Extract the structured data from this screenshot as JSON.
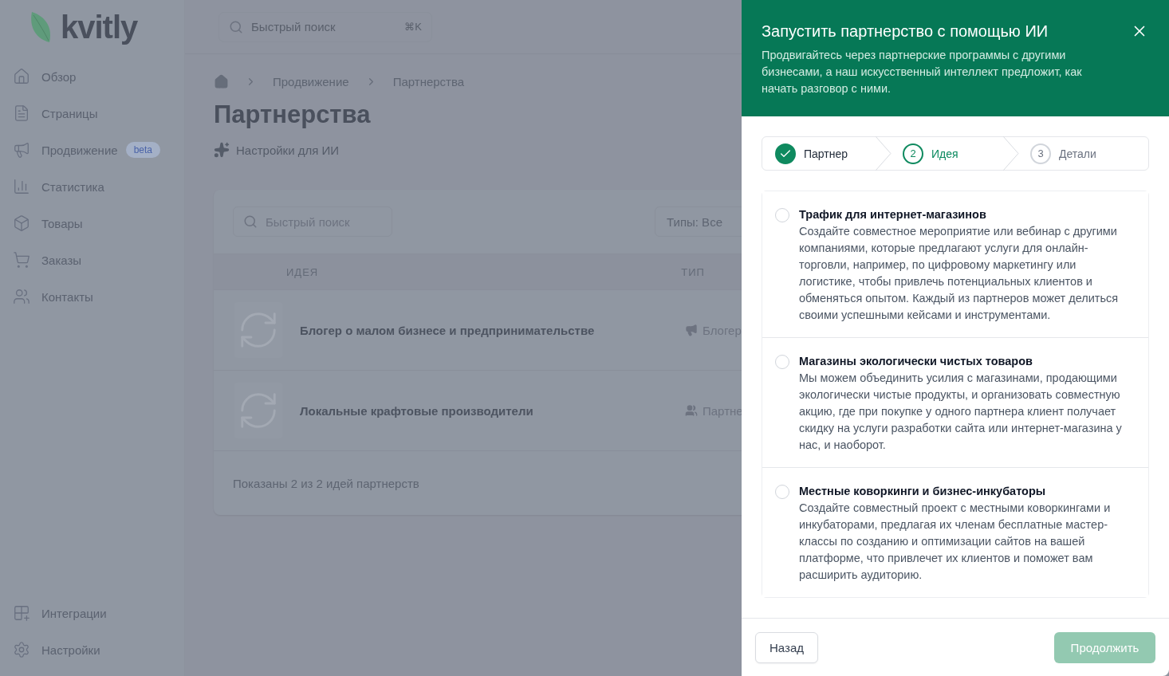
{
  "sidebar": {
    "logo": "kvitly",
    "nav": [
      {
        "label": "Обзор"
      },
      {
        "label": "Страницы"
      },
      {
        "label": "Продвижение",
        "badge": "beta"
      },
      {
        "label": "Статистика"
      },
      {
        "label": "Товары"
      },
      {
        "label": "Заказы"
      },
      {
        "label": "Контакты"
      }
    ],
    "bottom_nav": [
      {
        "label": "Интеграции"
      },
      {
        "label": "Настройки"
      }
    ]
  },
  "topbar": {
    "search": {
      "placeholder": "Быстрый поиск",
      "shortcut": "⌘K"
    }
  },
  "breadcrumbs": [
    "Продвижение",
    "Партнерства"
  ],
  "page_title": "Партнерства",
  "ai_settings_link": "Настройки для ИИ",
  "table": {
    "search": {
      "placeholder": "Быстрый поиск"
    },
    "filter": "Типы: Все",
    "columns": [
      "ИДЕЯ",
      "ТИП"
    ],
    "rows": [
      {
        "idea": "Блогер о малом бизнесе и предпринимательстве",
        "type": "Блогер"
      },
      {
        "idea": "Локальные крафтовые производители",
        "type": "Партне"
      }
    ],
    "footer": "Показаны 2 из 2 идей партнерств"
  },
  "drawer": {
    "title": "Запустить партнерство с помощью ИИ",
    "description": "Продвигайтесь через партнерские программы с другими бизнесами, а наш искусственный интеллект предложит, как начать разговор с ними.",
    "steps": [
      {
        "label": "Партнер",
        "done": true,
        "selected": false
      },
      {
        "number": "2",
        "label": "Идея",
        "done": false,
        "selected": true
      },
      {
        "number": "3",
        "label": "Детали",
        "done": false,
        "selected": false
      }
    ],
    "options": [
      {
        "title": "Трафик для интернет-магазинов",
        "description": "Создайте совместное мероприятие или вебинар с другими компаниями, которые предлагают услуги для онлайн-торговли, например, по цифровому маркетингу или логистике, чтобы привлечь потенциальных клиентов и обменяться опытом. Каждый из партнеров может делиться своими успешными кейсами и инструментами.",
        "selected": false
      },
      {
        "title": "Магазины экологически чистых товаров",
        "description": "Мы можем объединить усилия с магазинами, продающими экологически чистые продукты, и организовать совместную акцию, где при покупке у одного партнера клиент получает скидку на услуги разработки сайта или интернет-магазина у нас, и наоборот.",
        "selected": false
      },
      {
        "title": "Местные коворкинги и бизнес-инкубаторы",
        "description": "Создайте совместный проект с местными коворкингами и инкубаторами, предлагая их членам бесплатные мастер-классы по созданию и оптимизации сайтов на вашей платформе, что привлечет их клиентов и поможет вам расширить аудиторию.",
        "selected": false
      }
    ],
    "back_button": "Назад",
    "continue_button": {
      "label": "Продолжить",
      "disabled": true
    }
  }
}
